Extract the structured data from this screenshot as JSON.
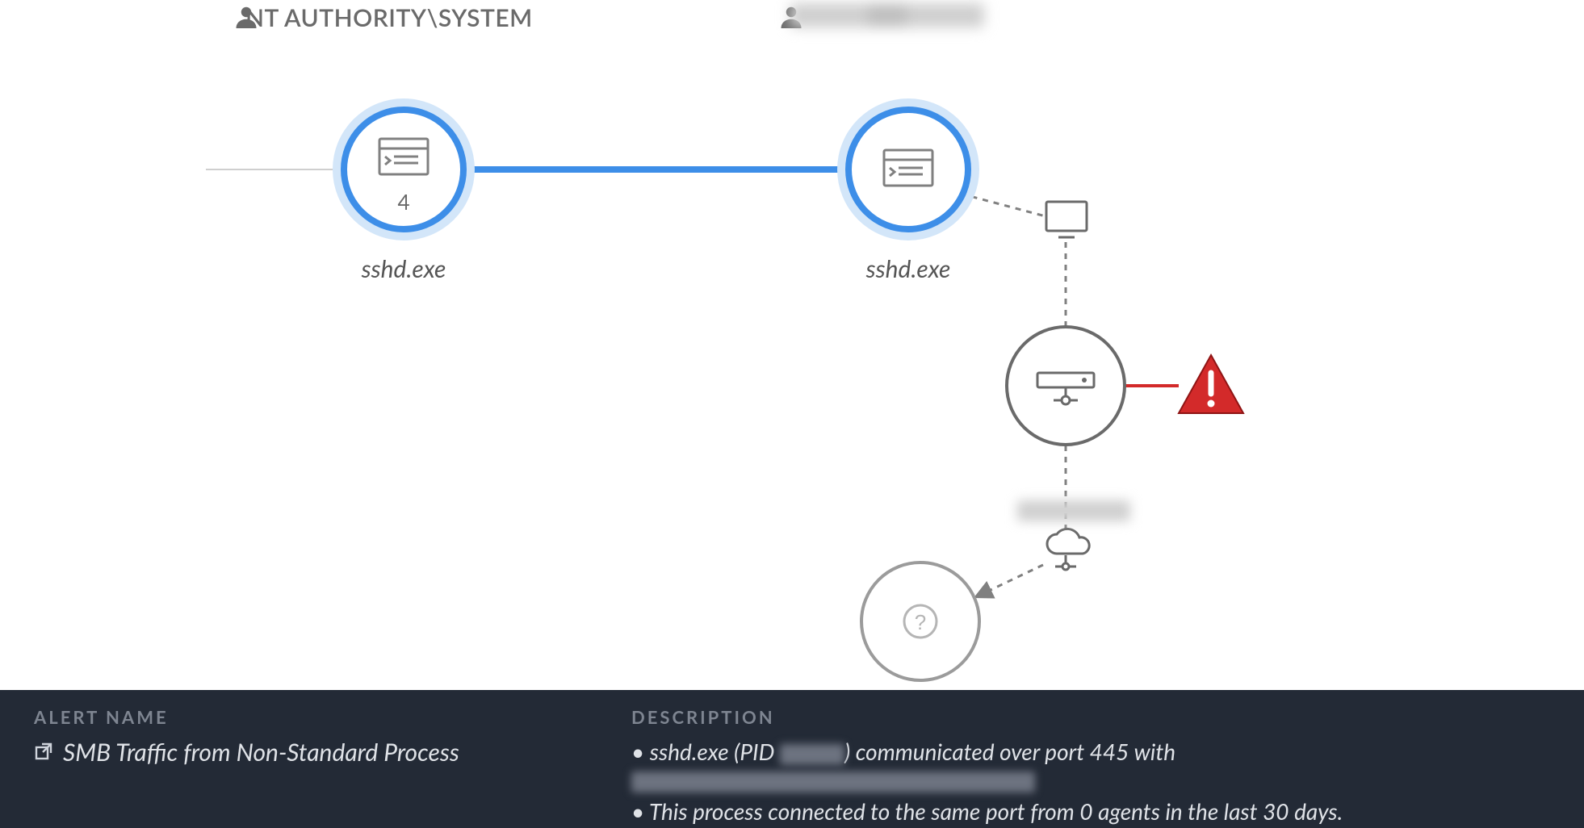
{
  "users": {
    "left": {
      "label": "NT AUTHORITY\\SYSTEM"
    },
    "right": {
      "label": "████████"
    }
  },
  "nodes": {
    "parent_process": {
      "label": "sshd.exe",
      "count": "4"
    },
    "child_process": {
      "label": "sshd.exe"
    },
    "monitor": {
      "label": ""
    },
    "network": {
      "label": ""
    },
    "cloud_host": {
      "label": "████"
    },
    "unknown": {
      "label": ""
    }
  },
  "alert": {
    "section_label": "ALERT NAME",
    "name": "SMB Traffic from Non-Standard Process"
  },
  "description": {
    "section_label": "DESCRIPTION",
    "line1_a": "sshd.exe (PID ",
    "line1_b": ") communicated over port 445 with ",
    "line2": "This process connected to the same port from 0 agents in the last 30 days."
  },
  "colors": {
    "accent_blue": "#3d8ee8",
    "accent_blue_fill": "#d3e6f9",
    "danger_red": "#d32a2a",
    "grey": "#6a6a6a",
    "panel_bg": "#232a36"
  }
}
